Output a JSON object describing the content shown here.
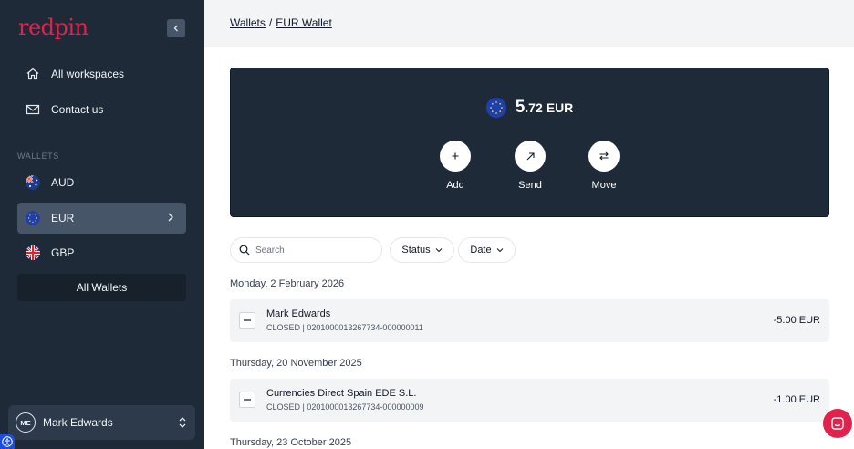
{
  "brand": {
    "logo_text": "redpin",
    "accent": "#e0224d"
  },
  "sidebar": {
    "nav": [
      {
        "label": "All workspaces",
        "icon": "home-icon"
      },
      {
        "label": "Contact us",
        "icon": "mail-icon"
      }
    ],
    "wallets_label": "WALLETS",
    "wallets": [
      {
        "label": "AUD",
        "icon": "australia-flag-icon",
        "active": false
      },
      {
        "label": "EUR",
        "icon": "eu-flag-icon",
        "active": true
      },
      {
        "label": "GBP",
        "icon": "uk-flag-icon",
        "active": false
      }
    ],
    "all_wallets_label": "All Wallets",
    "user": {
      "initials": "ME",
      "name": "Mark Edwards"
    }
  },
  "breadcrumb": {
    "root": "Wallets",
    "separator": "/",
    "current": "EUR Wallet"
  },
  "balance": {
    "integer": "5",
    "decimal": ".72",
    "currency": "EUR",
    "actions": [
      {
        "label": "Add",
        "icon": "plus-icon"
      },
      {
        "label": "Send",
        "icon": "arrow-up-right-icon"
      },
      {
        "label": "Move",
        "icon": "swap-arrows-icon"
      }
    ]
  },
  "filters": {
    "search_placeholder": "Search",
    "status_label": "Status",
    "date_label": "Date"
  },
  "transactions": [
    {
      "date": "Monday, 2 February 2026",
      "name": "Mark Edwards",
      "sub": "CLOSED | 0201000013267734-000000011",
      "amount": "-5.00 EUR"
    },
    {
      "date": "Thursday, 20 November 2025",
      "name": "Currencies Direct Spain EDE S.L.",
      "sub": "CLOSED | 0201000013267734-000000009",
      "amount": "-1.00 EUR"
    }
  ],
  "next_date": "Thursday, 23 October 2025"
}
